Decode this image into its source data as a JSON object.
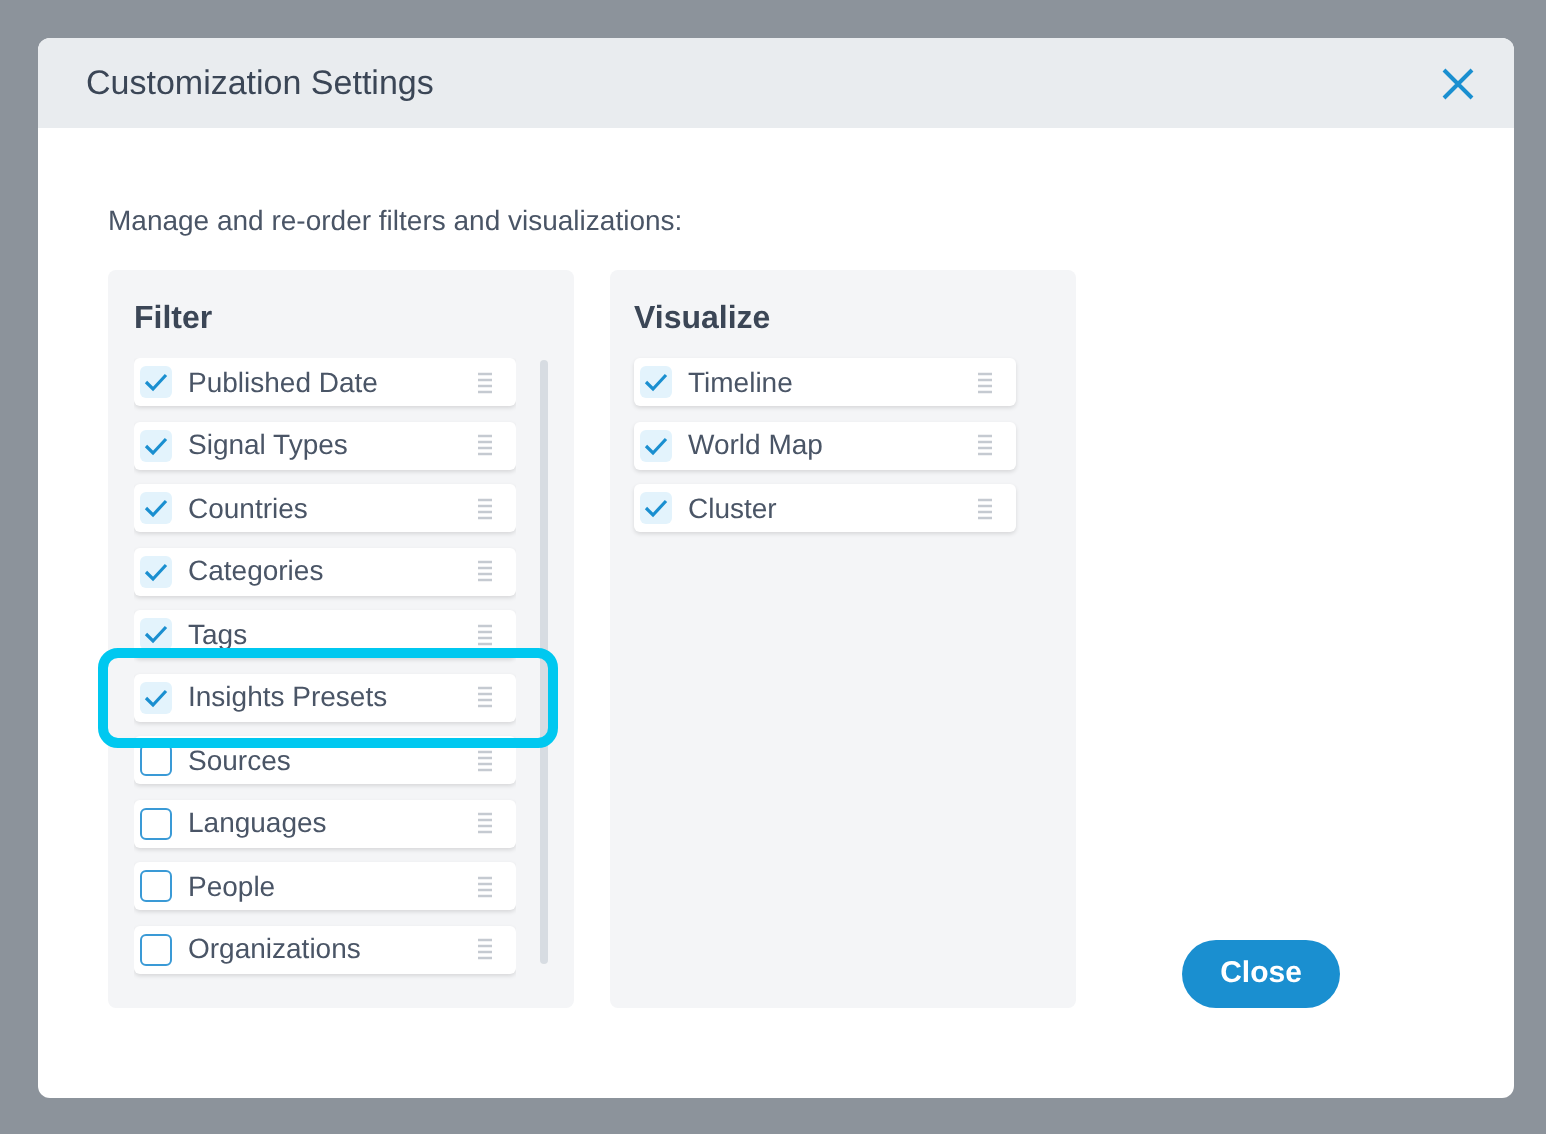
{
  "dialog": {
    "title": "Customization Settings",
    "instructions": "Manage and re-order filters and visualizations:"
  },
  "filter": {
    "title": "Filter",
    "items": [
      {
        "label": "Published Date",
        "checked": true,
        "highlighted": false
      },
      {
        "label": "Signal Types",
        "checked": true,
        "highlighted": false
      },
      {
        "label": "Countries",
        "checked": true,
        "highlighted": false
      },
      {
        "label": "Categories",
        "checked": true,
        "highlighted": false
      },
      {
        "label": "Tags",
        "checked": true,
        "highlighted": false
      },
      {
        "label": "Insights Presets",
        "checked": true,
        "highlighted": true
      },
      {
        "label": "Sources",
        "checked": false,
        "highlighted": false
      },
      {
        "label": "Languages",
        "checked": false,
        "highlighted": false
      },
      {
        "label": "People",
        "checked": false,
        "highlighted": false
      },
      {
        "label": "Organizations",
        "checked": false,
        "highlighted": false
      }
    ]
  },
  "visualize": {
    "title": "Visualize",
    "items": [
      {
        "label": "Timeline",
        "checked": true,
        "highlighted": false
      },
      {
        "label": "World Map",
        "checked": true,
        "highlighted": false
      },
      {
        "label": "Cluster",
        "checked": true,
        "highlighted": false
      }
    ]
  },
  "buttons": {
    "close": "Close"
  }
}
